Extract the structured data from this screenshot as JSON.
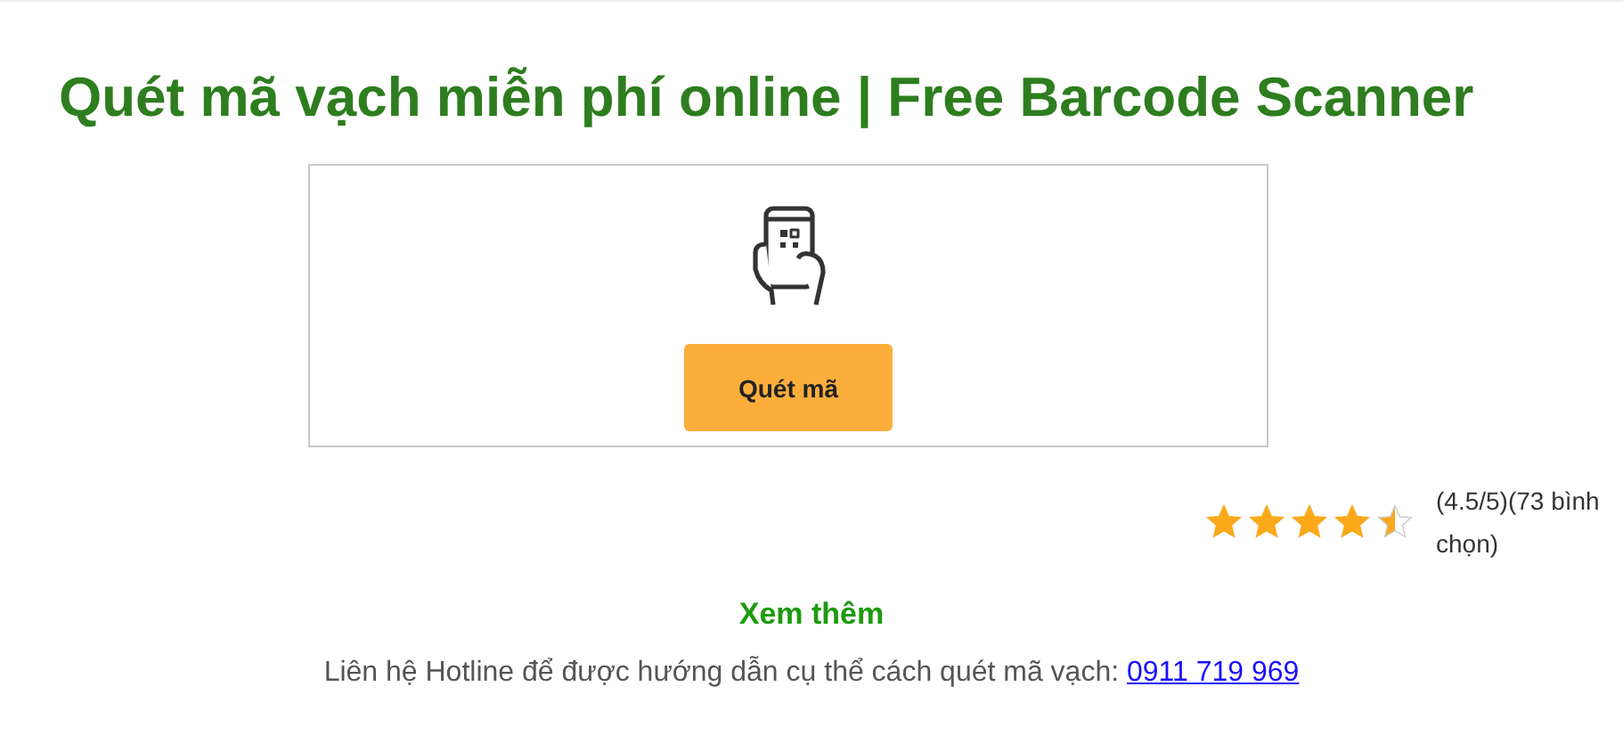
{
  "title": "Quét mã vạch miễn phí online | Free Barcode Scanner",
  "scanner": {
    "button": "Quét mã"
  },
  "rating": {
    "stars": 4.5,
    "text": "(4.5/5)(73 bình chọn)"
  },
  "more_link": "Xem thêm",
  "hotline": {
    "text": "Liên hệ Hotline để được hướng dẫn cụ thể cách quét mã vạch: ",
    "phone": "0911 719 969"
  }
}
